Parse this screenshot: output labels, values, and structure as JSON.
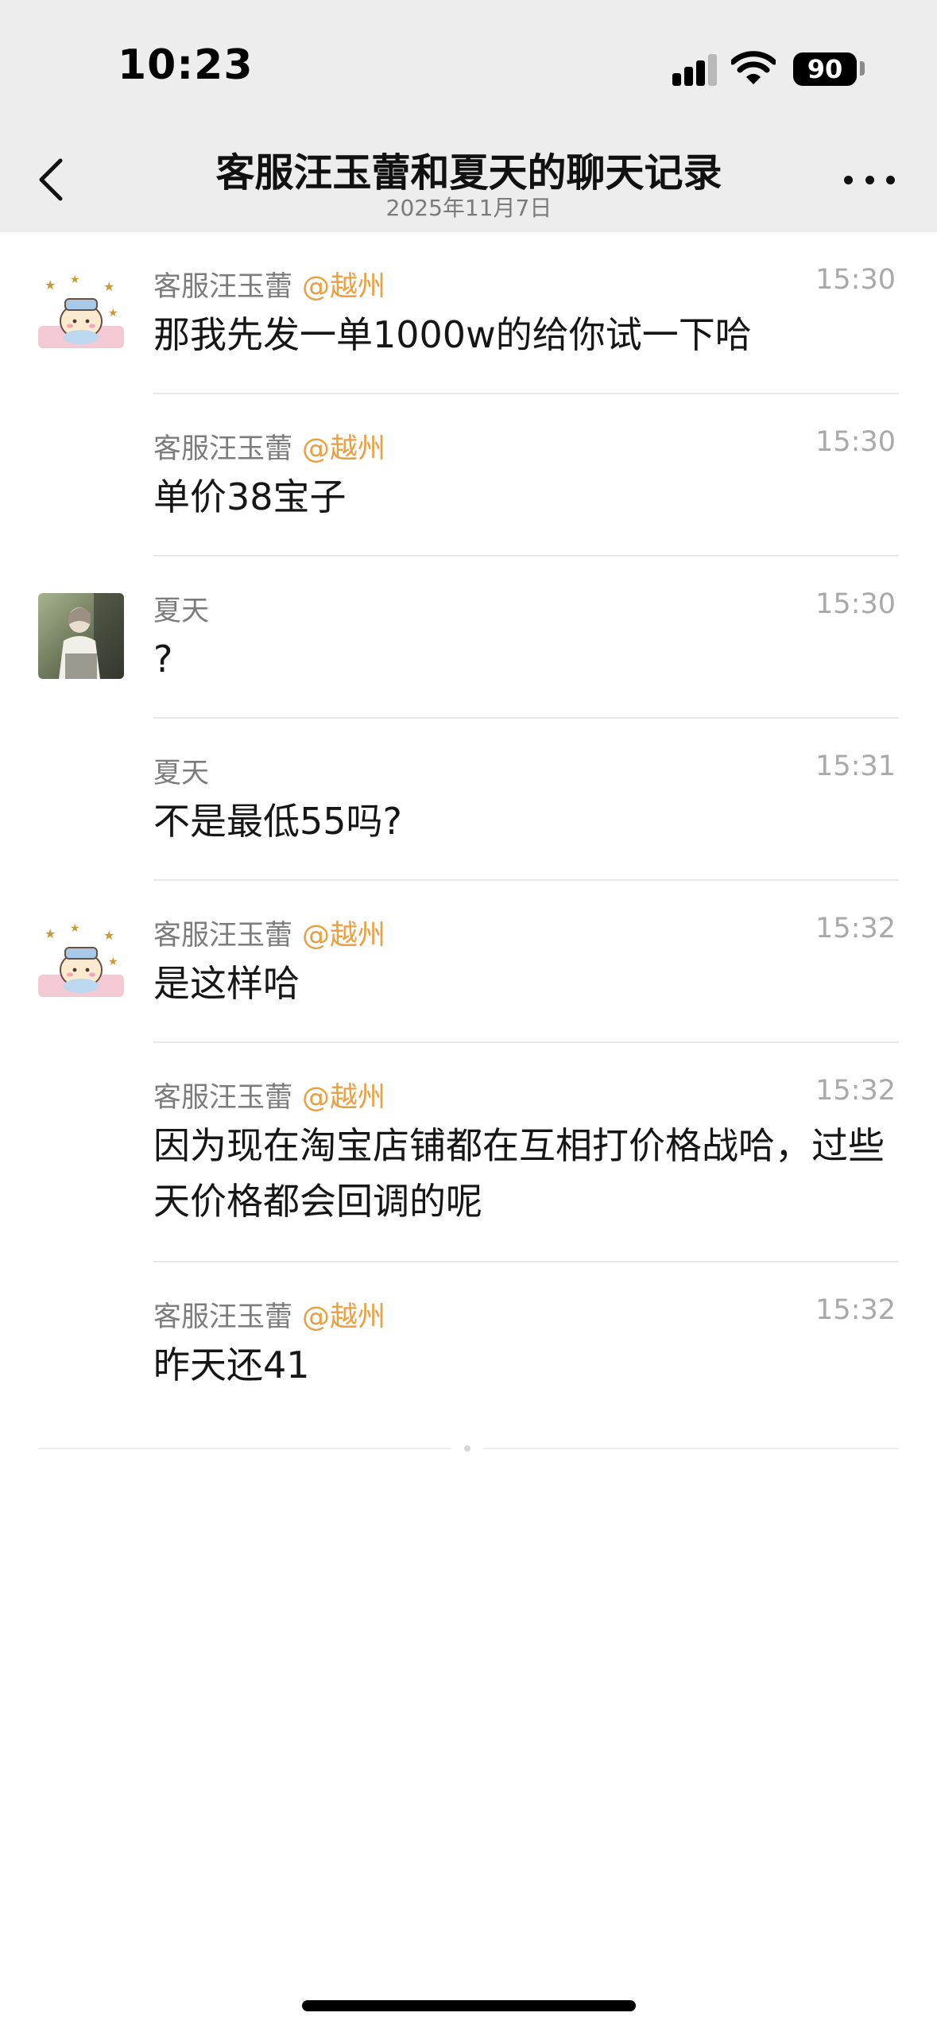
{
  "status_bar": {
    "time": "10:23",
    "battery": "90",
    "signal_icon": "cellular-signal-icon",
    "wifi_icon": "wifi-icon"
  },
  "header": {
    "title": "客服汪玉蕾和夏天的聊天记录",
    "subtitle": "2025年11月7日",
    "back_icon": "chevron-left-icon",
    "more_icon": "ellipsis-icon"
  },
  "colors": {
    "header_bg": "#ededed",
    "location_tag": "#e9a042",
    "sender": "#7c7c7c",
    "timestamp": "#a9a9a9"
  },
  "messages": [
    {
      "sender": "客服汪玉蕾",
      "location": "@越州",
      "time": "15:30",
      "text": "那我先发一单1000w的给你试一下哈",
      "avatar": "cartoon-avatar"
    },
    {
      "sender": "客服汪玉蕾",
      "location": "@越州",
      "time": "15:30",
      "text": "单价38宝子"
    },
    {
      "sender": "夏天",
      "location": "",
      "time": "15:30",
      "text": "?",
      "avatar": "photo-avatar"
    },
    {
      "sender": "夏天",
      "location": "",
      "time": "15:31",
      "text": "不是最低55吗?"
    },
    {
      "sender": "客服汪玉蕾",
      "location": "@越州",
      "time": "15:32",
      "text": "是这样哈",
      "avatar": "cartoon-avatar"
    },
    {
      "sender": "客服汪玉蕾",
      "location": "@越州",
      "time": "15:32",
      "text": "因为现在淘宝店铺都在互相打价格战哈，过些天价格都会回调的呢"
    },
    {
      "sender": "客服汪玉蕾",
      "location": "@越州",
      "time": "15:32",
      "text": "昨天还41"
    }
  ]
}
